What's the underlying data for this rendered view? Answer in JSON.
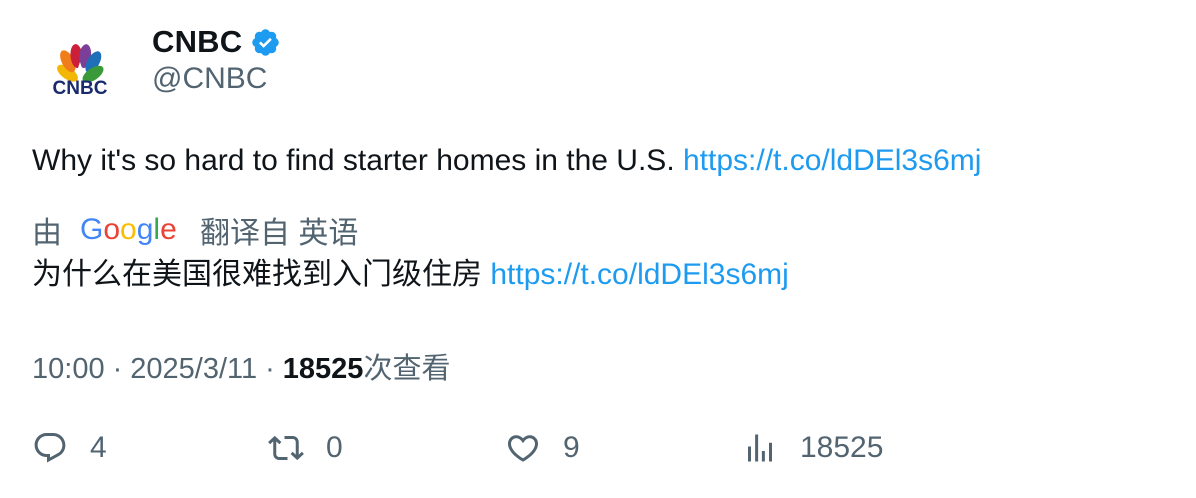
{
  "account": {
    "display_name": "CNBC",
    "handle": "@CNBC",
    "avatar_text": "CNBC",
    "verified_color": "#1d9bf0"
  },
  "tweet": {
    "text": "Why it's so hard to find starter homes in the U.S. ",
    "link": "https://t.co/ldDEl3s6mj"
  },
  "translation": {
    "by_label": "由",
    "provider": "Google",
    "translated_from_label": "翻译自 英语",
    "text": "为什么在美国很难找到入门级住房 ",
    "link": "https://t.co/ldDEl3s6mj"
  },
  "meta": {
    "time": "10:00",
    "separator": "·",
    "date": "2025/3/11",
    "views": "18525",
    "views_label": "次查看"
  },
  "actions": {
    "reply": {
      "icon": "reply-icon",
      "count": "4"
    },
    "retweet": {
      "icon": "retweet-icon",
      "count": "0"
    },
    "like": {
      "icon": "heart-icon",
      "count": "9"
    },
    "views": {
      "icon": "views-chart-icon",
      "count": "18525"
    }
  },
  "colors": {
    "text": "#0f1419",
    "secondary": "#536471",
    "link": "#1d9bf0"
  }
}
